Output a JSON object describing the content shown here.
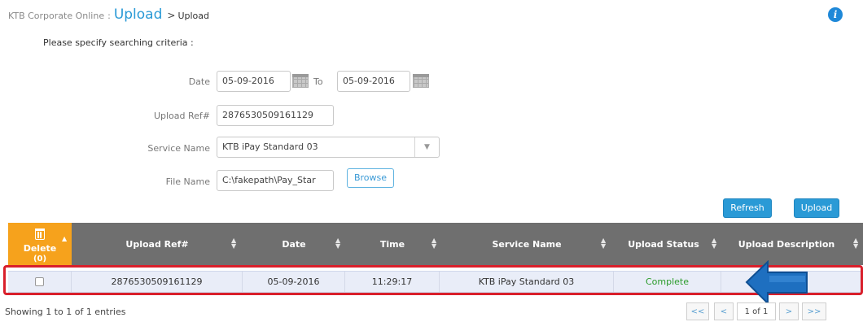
{
  "breadcrumb": {
    "app": "KTB Corporate Online",
    "separator": ":",
    "section": "Upload",
    "arrow": ">",
    "page": "Upload"
  },
  "info_icon": "i",
  "criteria_title": "Please specify searching criteria :",
  "form": {
    "date_label": "Date",
    "date_from": "05-09-2016",
    "to_label": "To",
    "date_to": "05-09-2016",
    "upload_ref_label": "Upload Ref#",
    "upload_ref_value": "2876530509161129",
    "service_name_label": "Service Name",
    "service_name_value": "KTB iPay Standard 03",
    "file_name_label": "File Name",
    "file_name_value": "C:\\fakepath\\Pay_Star",
    "browse_label": "Browse"
  },
  "actions": {
    "refresh_label": "Refresh",
    "upload_label": "Upload"
  },
  "table": {
    "delete_header": "Delete",
    "delete_count": "(0)",
    "columns": [
      "Upload Ref#",
      "Date",
      "Time",
      "Service Name",
      "Upload Status",
      "Upload Description"
    ],
    "rows": [
      {
        "upload_ref": "2876530509161129",
        "date": "05-09-2016",
        "time": "11:29:17",
        "service_name": "KTB iPay Standard 03",
        "status": "Complete",
        "description": ""
      }
    ]
  },
  "entries_info": "Showing 1 to 1 of 1 entries",
  "pager": {
    "first": "<<",
    "prev": "<",
    "page": "1 of 1",
    "next": ">",
    "last": ">>"
  },
  "colors": {
    "accent": "#2a9ad6",
    "header_bg": "#6f6f6f",
    "delete_bg": "#f6a21c",
    "highlight": "#d91f2b",
    "status_complete": "#2a9b2a",
    "arrow": "#1e6fc0"
  },
  "overlay": {
    "arrow_icon": "left-arrow-icon"
  }
}
